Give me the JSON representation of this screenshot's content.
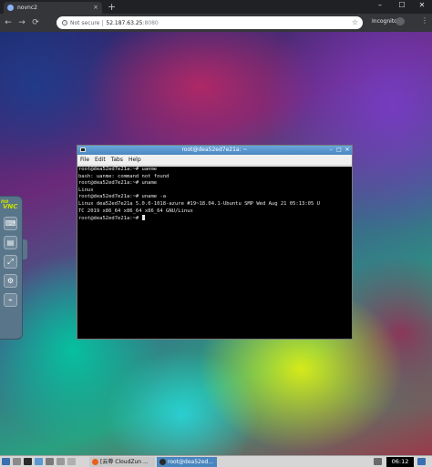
{
  "browser": {
    "tab_title": "novnc2",
    "tab_close": "×",
    "new_tab": "+",
    "window_controls": [
      "–",
      "☐",
      "✕"
    ],
    "nav": {
      "back": "←",
      "forward": "→",
      "reload": "⟳"
    },
    "url_security": "Not secure",
    "url_host": "52.187.63.25",
    "url_port": ":8080",
    "bookmark_star": "☆",
    "incognito_label": "Incognito",
    "menu": "⋮"
  },
  "vnc_panel": {
    "logo": "no",
    "logo_main": "VNC",
    "buttons": [
      {
        "icon": "keyboard-icon",
        "glyph": "⌨"
      },
      {
        "icon": "clipboard-icon",
        "glyph": "▤"
      },
      {
        "icon": "fullscreen-icon",
        "glyph": "⤢"
      },
      {
        "icon": "settings-gear-icon",
        "glyph": "⚙"
      },
      {
        "icon": "disconnect-icon",
        "glyph": "⌁"
      }
    ]
  },
  "terminal": {
    "title": "root@dea52ed7e21a: ~",
    "menu": [
      "File",
      "Edit",
      "Tabs",
      "Help"
    ],
    "lines": [
      "root@dea52ed7e21a:~# uanme",
      "bash: uanme: command not found",
      "root@dea52ed7e21a:~# uname",
      "Linux",
      "root@dea52ed7e21a:~# uname -a",
      "Linux dea52ed7e21a 5.0.0-1018-azure #19~18.04.1-Ubuntu SMP Wed Aug 21 05:13:05 U",
      "TC 2019 x86_64 x86_64 x86_64 GNU/Linux"
    ],
    "prompt": "root@dea52ed7e21a:~# "
  },
  "taskbar": {
    "tasks": [
      {
        "label": "[云尊 CloudZun ...",
        "color": "#e8601c"
      },
      {
        "label": "root@dea52ed...",
        "color": "#2a2a2a"
      }
    ],
    "clock": "06:12"
  }
}
